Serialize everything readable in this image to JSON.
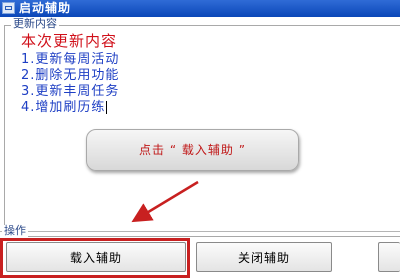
{
  "window": {
    "title": "启动辅助"
  },
  "update_group": {
    "legend": "更新内容",
    "heading": "本次更新内容",
    "items": [
      "1.更新每周活动",
      "2.删除无用功能",
      "3.更新丰周任务",
      "4.增加刷历练"
    ]
  },
  "callout": {
    "text": "点击 “ 载入辅助 ”"
  },
  "actions_group": {
    "legend": "操作",
    "load_label": "载入辅助",
    "close_label": "关闭辅助"
  },
  "colors": {
    "titlebar": "#0b47b8",
    "heading_text": "#d0101a",
    "item_text": "#1e3fc4",
    "highlight": "#c82020"
  }
}
